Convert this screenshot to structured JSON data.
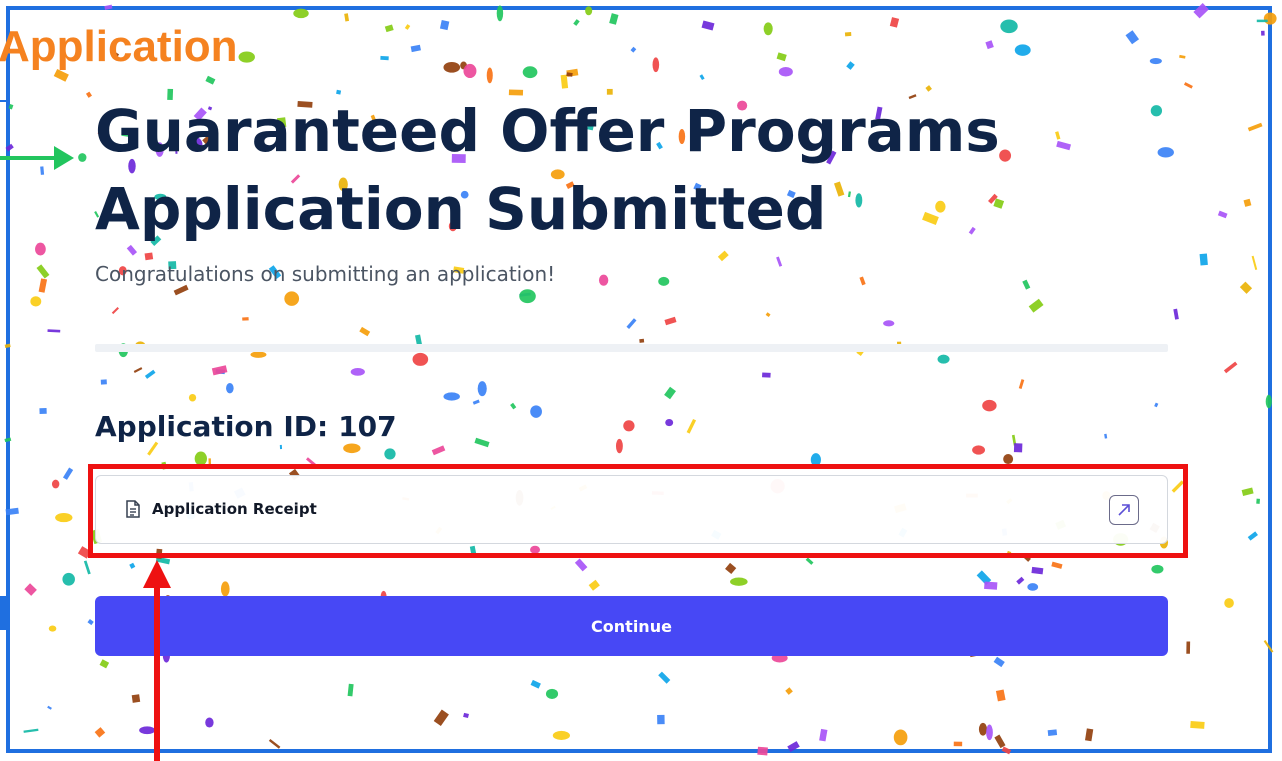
{
  "annotation": {
    "corner_label": "Application",
    "corner_label_color": "#f58220",
    "highlight_color": "#ee1111",
    "pointer_arrow_color": "#ee1111",
    "side_arrow_color": "#22c55e"
  },
  "page": {
    "title": "Guaranteed Offer Programs Application Submitted",
    "subtitle": "Congratulations on submitting an application!",
    "application_id_label": "Application ID:",
    "application_id": "107"
  },
  "receipt": {
    "icon": "document-icon",
    "label": "Application Receipt",
    "action_icon": "external-link-icon"
  },
  "actions": {
    "continue_label": "Continue",
    "accent": "#4748f5"
  },
  "theme": {
    "title_color": "#0f2447",
    "frame_color": "#1f6fe0"
  }
}
